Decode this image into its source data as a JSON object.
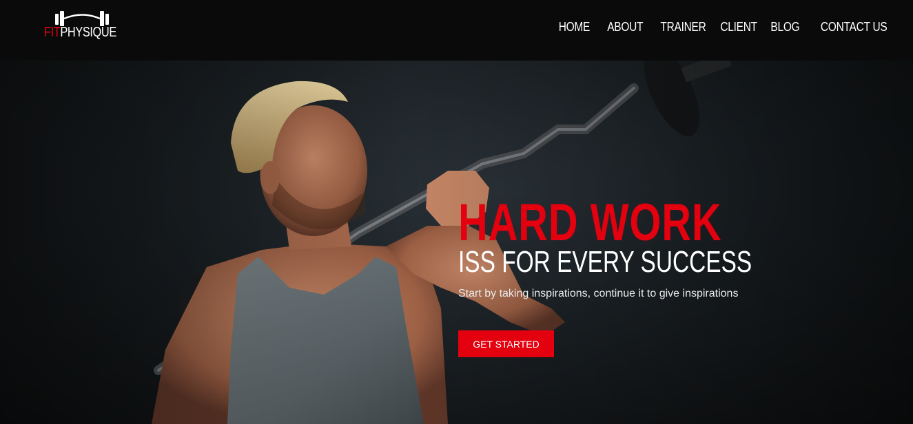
{
  "brand": {
    "fit": "FIT",
    "physique": "PHYSIQUE",
    "accent": "#e3000f"
  },
  "nav": {
    "items": [
      {
        "label": "HOME"
      },
      {
        "label": "ABOUT"
      },
      {
        "label": "TRAINER"
      },
      {
        "label": "CLIENT"
      },
      {
        "label": "BLOG"
      },
      {
        "label": "CONTACT US"
      }
    ]
  },
  "hero": {
    "headline": "HARD WORK",
    "subheadline": "ISS FOR EVERY SUCCESS",
    "tagline": "Start by taking inspirations, continue it to give inspirations",
    "cta_label": "GET STARTED",
    "image_alt_icon": "athlete-with-barbell-photo"
  }
}
